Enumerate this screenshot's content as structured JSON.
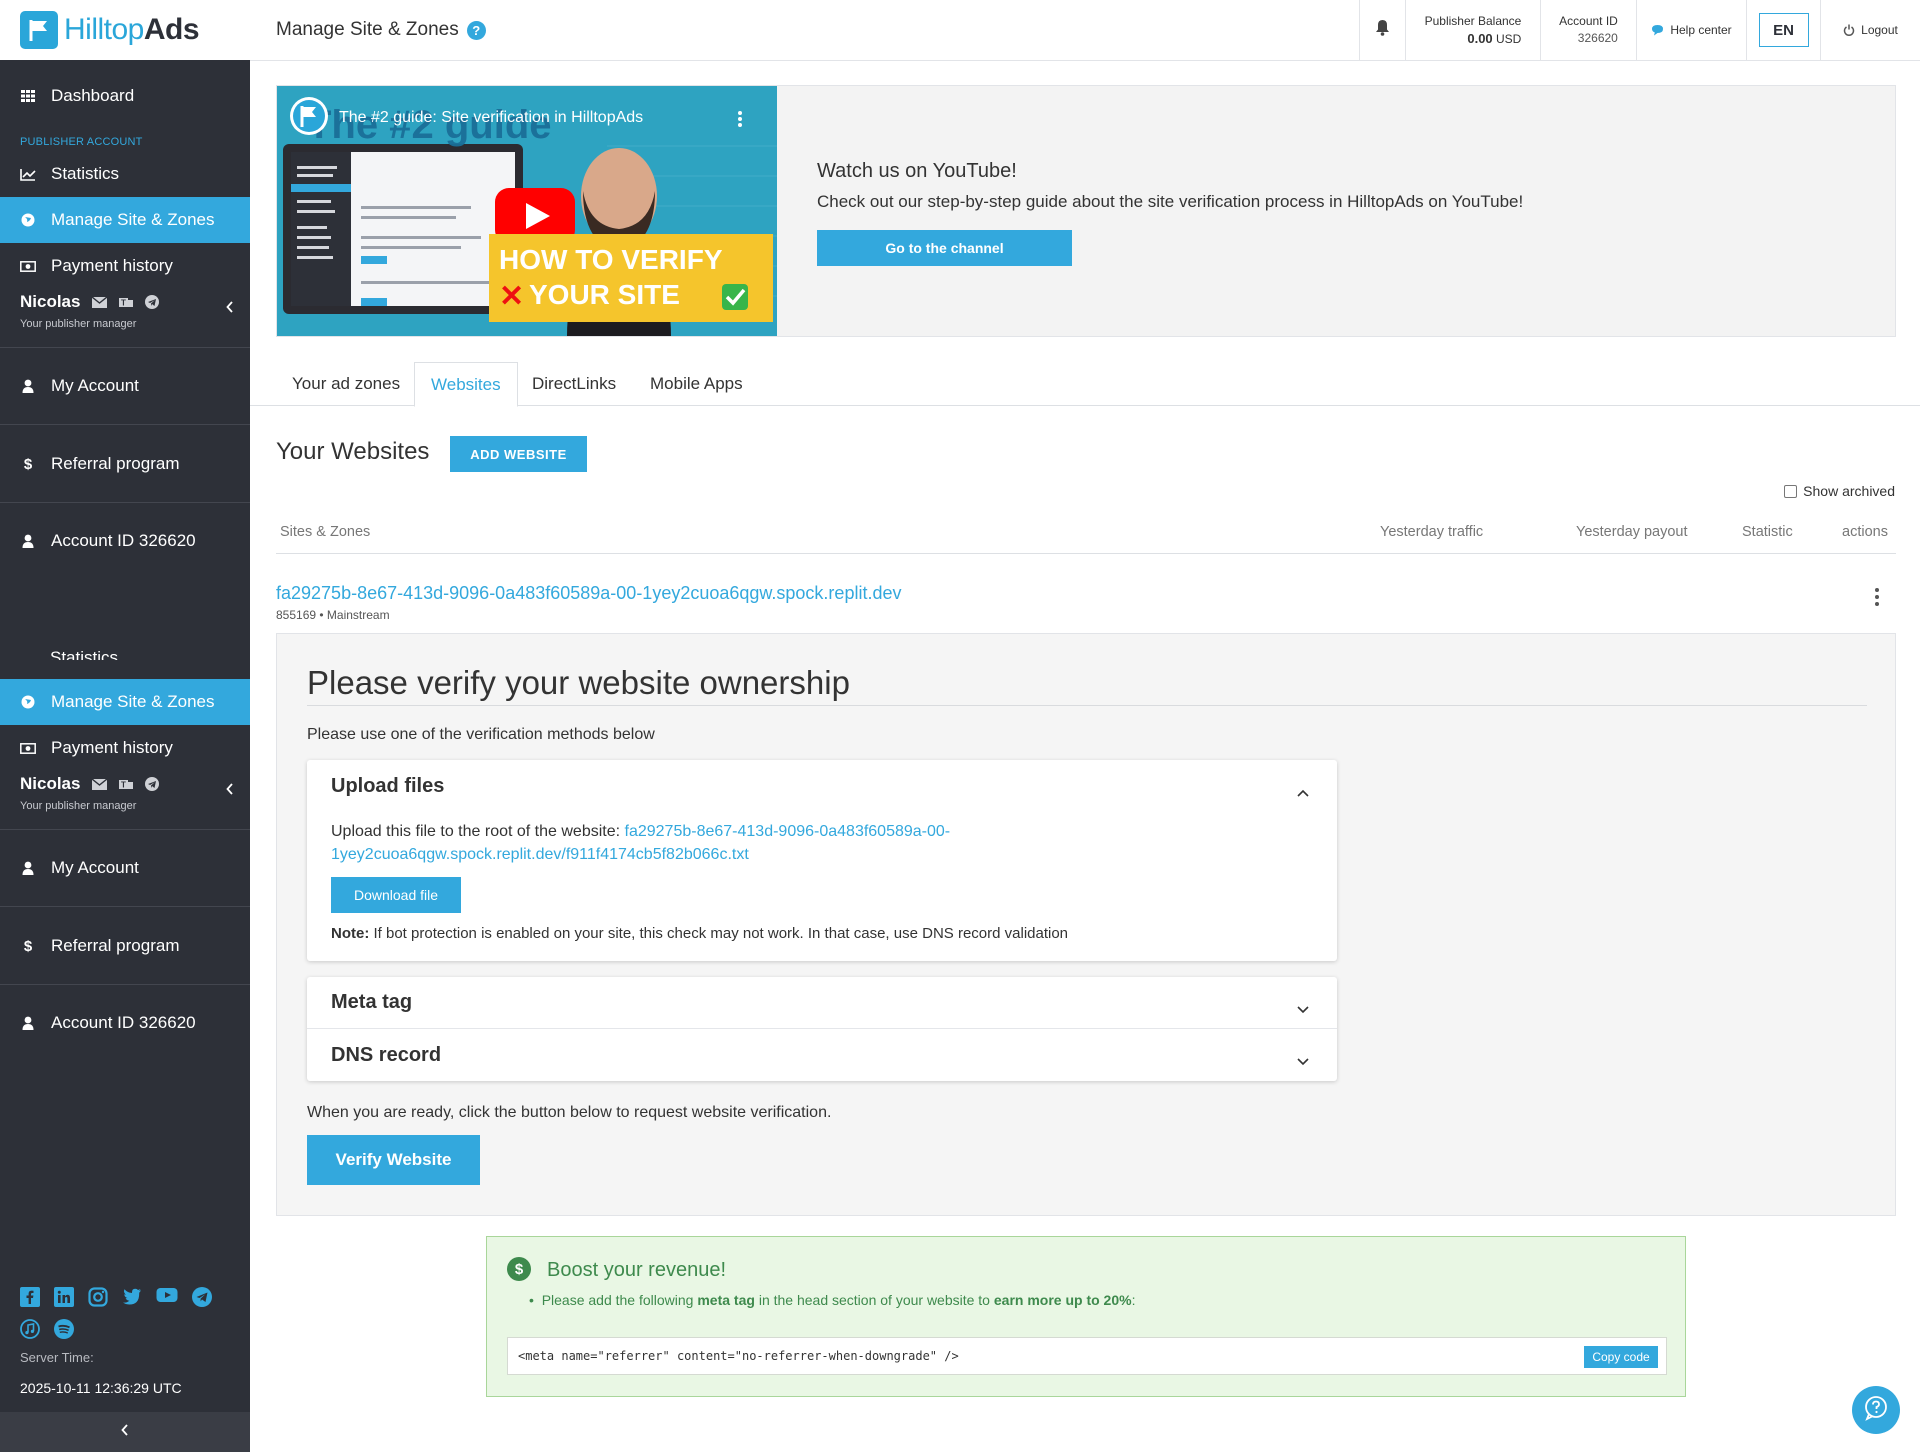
{
  "brand": {
    "name_part1": "Hilltop",
    "name_part2": "Ads",
    "accent": "#33a8dd",
    "sidebar_bg": "#2d3038"
  },
  "topbar": {
    "page_title": "Manage Site & Zones",
    "help_badge": "?",
    "balance_label": "Publisher Balance",
    "balance_value": "0.00",
    "balance_currency": "USD",
    "account_label": "Account ID",
    "account_value": "326620",
    "help_center": "Help center",
    "language": "EN",
    "logout": "Logout"
  },
  "sidebar": {
    "dashboard": "Dashboard",
    "section_label": "PUBLISHER ACCOUNT",
    "statistics": "Statistics",
    "manage": "Manage Site & Zones",
    "payment_history": "Payment history",
    "manager_name": "Nicolas",
    "manager_sub": "Your publisher manager",
    "my_account": "My Account",
    "referral": "Referral program",
    "account_id": "Account ID 326620",
    "partial_item": "Statistics",
    "server_time_label": "Server Time:",
    "server_time": "2025-10-11 12:36:29 UTC",
    "social_icons": [
      "facebook-icon",
      "linkedin-icon",
      "instagram-icon",
      "twitter-icon",
      "youtube-icon",
      "telegram-icon",
      "apple-music-icon",
      "spotify-icon"
    ]
  },
  "video": {
    "title": "The #2 guide: Site verification in HilltopAds",
    "overlay_big": "The #2 guide",
    "overlay_verify1": "HOW TO VERIFY",
    "overlay_verify2": "YOUR SITE",
    "heading": "Watch us on YouTube!",
    "text": "Check out our step-by-step guide about the site verification process in HilltopAds on YouTube!",
    "button": "Go to the channel"
  },
  "tabs": [
    {
      "label": "Your ad zones",
      "active": false
    },
    {
      "label": "Websites",
      "active": true
    },
    {
      "label": "DirectLinks",
      "active": false
    },
    {
      "label": "Mobile Apps",
      "active": false
    }
  ],
  "websites": {
    "title": "Your Websites",
    "add_button": "ADD WEBSITE",
    "show_archived": "Show archived",
    "columns": {
      "sites": "Sites & Zones",
      "traffic": "Yesterday traffic",
      "payout": "Yesterday payout",
      "statistic": "Statistic",
      "actions": "actions"
    },
    "site": {
      "domain": "fa29275b-8e67-413d-9096-0a483f60589a-00-1yey2cuoa6qgw.spock.replit.dev",
      "id": "855169",
      "category": "Mainstream"
    }
  },
  "verify": {
    "heading": "Please verify your website ownership",
    "intro": "Please use one of the verification methods below",
    "upload_title": "Upload files",
    "upload_text": "Upload this file to the root of the website:",
    "upload_link_1": "fa29275b-8e67-413d-9096-0a483f60589a-00-",
    "upload_link_2": "1yey2cuoa6qgw.spock.replit.dev/f911f4174cb5f82b066c.txt",
    "download_button": "Download file",
    "note_label": "Note:",
    "note_text": "If bot protection is enabled on your site, this check may not work. In that case, use DNS record validation",
    "meta_title": "Meta tag",
    "dns_title": "DNS record",
    "ready_text": "When you are ready, click the button below to request website verification.",
    "verify_button": "Verify Website"
  },
  "boost": {
    "icon": "$",
    "heading": "Boost your revenue!",
    "text_1": "Please add the following",
    "text_bold_1": "meta tag",
    "text_2": "in the head section of your website to",
    "text_bold_2": "earn more up to 20%",
    "text_3": ":",
    "code": "<meta name=\"referrer\" content=\"no-referrer-when-downgrade\" />",
    "copy_button": "Copy code",
    "color": "#3e8a4d"
  }
}
